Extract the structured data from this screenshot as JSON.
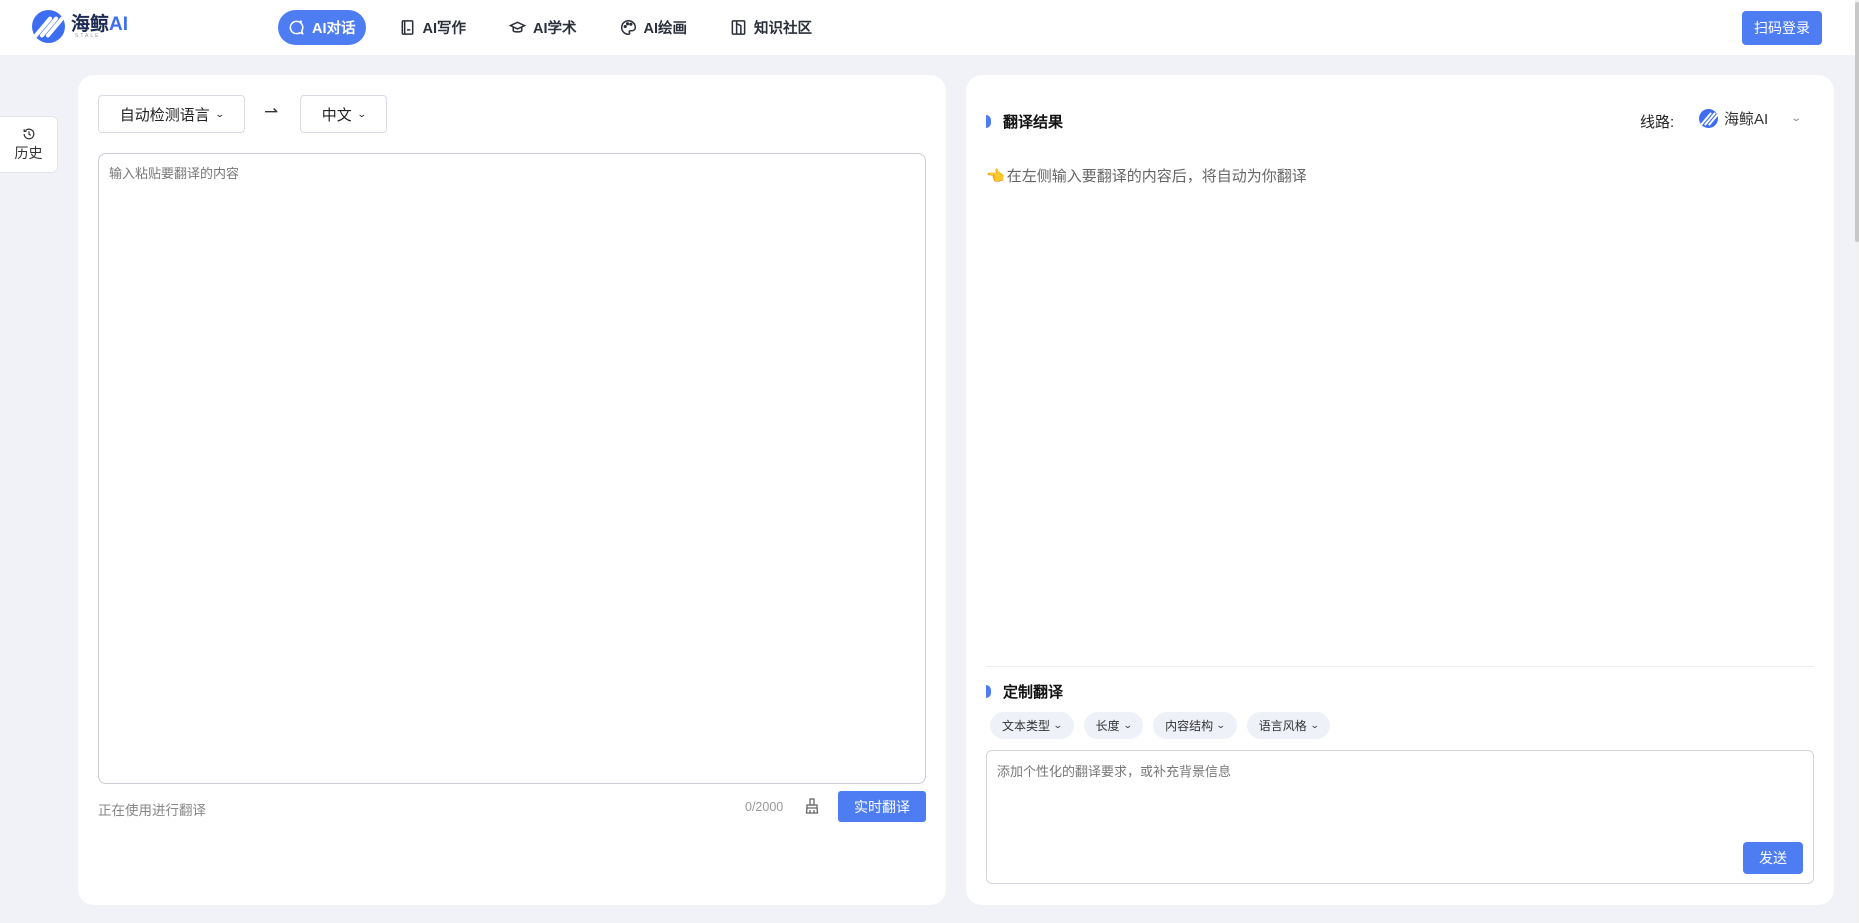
{
  "brand": {
    "name": "海鲸",
    "name_suffix": "AI",
    "sub": "STALE"
  },
  "nav": {
    "items": [
      {
        "label": "AI对话",
        "icon": "chat-bubble-icon",
        "active": true
      },
      {
        "label": "AI写作",
        "icon": "notebook-icon",
        "active": false
      },
      {
        "label": "AI学术",
        "icon": "graduation-cap-icon",
        "active": false
      },
      {
        "label": "AI绘画",
        "icon": "palette-icon",
        "active": false
      },
      {
        "label": "知识社区",
        "icon": "book-icon",
        "active": false
      }
    ],
    "login_label": "扫码登录"
  },
  "history": {
    "label": "历史",
    "icon": "history-clock-icon"
  },
  "translator": {
    "source_lang": "自动检测语言",
    "arrow": "⇀",
    "target_lang": "中文",
    "input_placeholder": "输入粘贴要翻译的内容",
    "status": "正在使用进行翻译",
    "char_count": "0/2000",
    "translate_label": "实时翻译"
  },
  "result": {
    "title": "翻译结果",
    "route_label": "线路:",
    "route_value": "海鲸AI",
    "hint": "在左侧输入要翻译的内容后，将自动为你翻译",
    "hint_icon": "👈"
  },
  "custom": {
    "title": "定制翻译",
    "chips": [
      "文本类型",
      "长度",
      "内容结构",
      "语言风格"
    ],
    "input_placeholder": "添加个性化的翻译要求，或补充背景信息",
    "send_label": "发送"
  },
  "colors": {
    "accent": "#4d7cf3",
    "background": "#f0f2f7"
  }
}
